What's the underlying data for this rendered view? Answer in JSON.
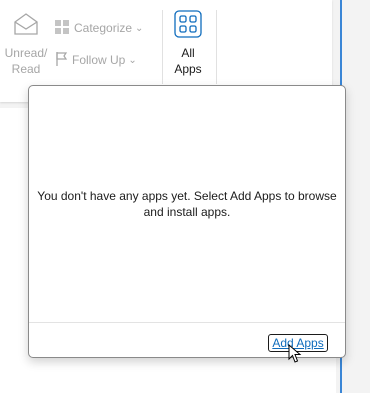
{
  "ribbon": {
    "unread_read_label": "Unread/ Read",
    "categorize_label": "Categorize",
    "follow_up_label": "Follow Up",
    "all_apps_label": "All Apps"
  },
  "apps_popup": {
    "message": "You don't have any apps yet. Select Add Apps to browse and install apps.",
    "add_apps_link": "Add Apps"
  },
  "colors": {
    "accent": "#0f6cbd",
    "disabled_text": "#a6a6a6",
    "right_border": "#3a86d6"
  }
}
